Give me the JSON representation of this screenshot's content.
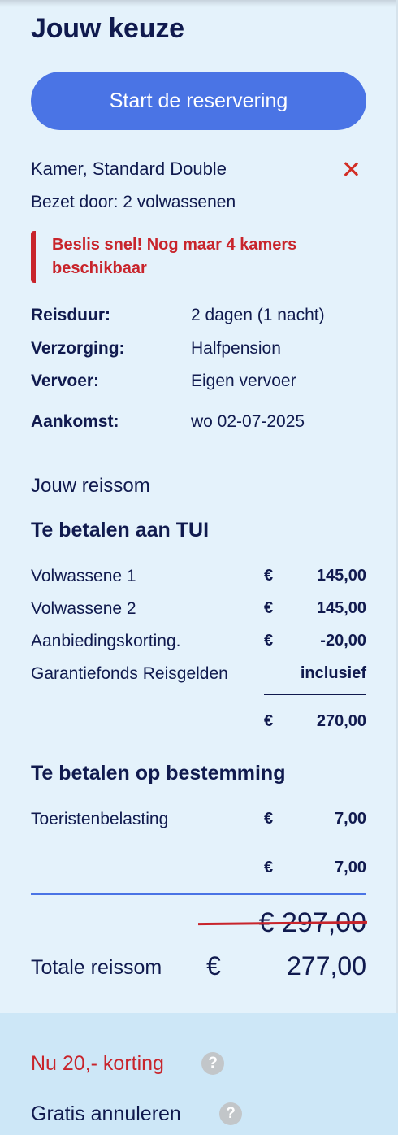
{
  "title": "Jouw keuze",
  "cta_label": "Start de reservering",
  "room": {
    "name": "Kamer, Standard Double",
    "occupancy": "Bezet door: 2 volwassenen"
  },
  "alert": "Beslis snel! Nog maar 4 kamers beschikbaar",
  "details": [
    {
      "label": "Reisduur:",
      "value": "2 dagen (1 nacht)"
    },
    {
      "label": "Verzorging:",
      "value": "Halfpension"
    },
    {
      "label": "Vervoer:",
      "value": "Eigen vervoer"
    },
    {
      "label": "Aankomst:",
      "value": "wo 02-07-2025"
    }
  ],
  "reissom": {
    "heading": "Jouw reissom",
    "tui": {
      "heading": "Te betalen aan TUI",
      "rows": [
        {
          "label": "Volwassene 1",
          "currency": "€",
          "amount": "145,00"
        },
        {
          "label": "Volwassene 2",
          "currency": "€",
          "amount": "145,00"
        },
        {
          "label": "Aanbiedingskorting.",
          "currency": "€",
          "amount": "-20,00"
        },
        {
          "label": "Garantiefonds Reisgelden",
          "currency": "",
          "amount": "inclusief"
        }
      ],
      "subtotal": {
        "currency": "€",
        "amount": "270,00"
      }
    },
    "destination": {
      "heading": "Te betalen op bestemming",
      "rows": [
        {
          "label": "Toeristenbelasting",
          "currency": "€",
          "amount": "7,00"
        }
      ],
      "subtotal": {
        "currency": "€",
        "amount": "7,00"
      }
    },
    "old_total": "€ 297,00",
    "total": {
      "label": "Totale reissom",
      "currency": "€",
      "amount": "277,00"
    }
  },
  "promo": [
    {
      "label": "Nu 20,- korting",
      "help": "?"
    },
    {
      "label": "Gratis annuleren",
      "help": "?"
    }
  ],
  "colors": {
    "background": "#e4f2fb",
    "accent_blue": "#4a74e5",
    "alert_red": "#c8242b",
    "text_navy": "#101a4e",
    "promo_background": "#cde7f7"
  },
  "icons": {
    "remove": "close-icon",
    "info": "help-icon"
  }
}
